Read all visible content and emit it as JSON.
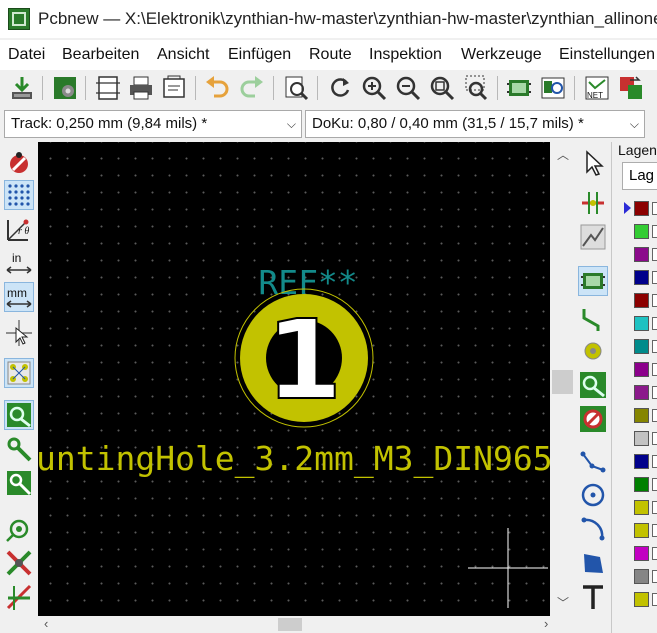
{
  "window": {
    "title": "Pcbnew — X:\\Elektronik\\zynthian-hw-master\\zynthian-hw-master\\zynthian_allinone"
  },
  "menu": [
    "Datei",
    "Bearbeiten",
    "Ansicht",
    "Einfügen",
    "Route",
    "Inspektion",
    "Werkzeuge",
    "Einstellungen"
  ],
  "toolbar": {
    "icons": [
      "save-icon",
      "board-setup-icon",
      "page-settings-icon",
      "print-icon",
      "plot-icon",
      "undo-icon",
      "redo-icon",
      "find-icon",
      "refresh-icon",
      "zoom-in-icon",
      "zoom-out-icon",
      "zoom-fit-icon",
      "zoom-selection-icon",
      "footprint-editor-icon",
      "footprint-browser-icon",
      "netlist-icon",
      "update-pcb-icon"
    ]
  },
  "selectors": {
    "track": "Track: 0,250 mm (9,84 mils) *",
    "via": "DoKu: 0,80 / 0,40 mm (31,5 / 15,7 mils) *"
  },
  "left_toolbar": [
    "drc-icon",
    "grid-icon",
    "polar-coords-icon",
    "inch-units-icon",
    "mm-units-icon",
    "full-cursor-icon",
    "ratsnest-icon",
    "zone-fill-icon",
    "pad-sketch-icon",
    "via-sketch-icon",
    "track-sketch-icon",
    "high-contrast-icon",
    "layer-flip-icon"
  ],
  "right_toolbar": [
    "select-icon",
    "local-ratsnest-icon",
    "footprint-tool-icon",
    "add-footprint-icon",
    "route-track-icon",
    "add-via-icon",
    "add-zone-icon",
    "add-keepout-icon",
    "add-line-icon",
    "add-circle-icon",
    "add-arc-icon",
    "add-polygon-icon",
    "add-text-icon"
  ],
  "canvas": {
    "ref_text": "REF**",
    "pad_number": "1",
    "footprint_value": "untingHole_3.2mm_M3_DIN965_",
    "colors": {
      "background": "#000000",
      "ref": "#138a8a",
      "pad": "#c2c200",
      "value": "#c2c200"
    }
  },
  "layers_panel": {
    "title": "Lagen",
    "tab": "Lag",
    "swatches": [
      "#8b0000",
      "#33cc33",
      "#8b0a8b",
      "#00008b",
      "#8b0000",
      "#1ec2c2",
      "#008b8b",
      "#8b008b",
      "#8b1a8b",
      "#858500",
      "#c2c2c2",
      "#00008b",
      "#008000",
      "#c2c200",
      "#c2c200",
      "#c200c2",
      "#858585",
      "#c2c200"
    ]
  }
}
